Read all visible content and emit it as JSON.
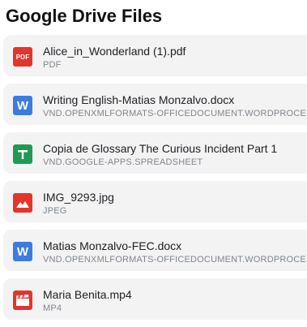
{
  "page": {
    "title": "Google Drive Files"
  },
  "files": [
    {
      "name": "Alice_in_Wonderland (1).pdf",
      "type": "PDF",
      "icon": "pdf-icon",
      "icon_text": "PDF",
      "icon_color": "#e2352c"
    },
    {
      "name": "Writing English-Matias Monzalvo.docx",
      "type": "VND.OPENXMLFORMATS-OFFICEDOCUMENT.WORDPROCESSINGML.DOCUMENT",
      "icon": "word-doc-icon",
      "icon_text": "W",
      "icon_color": "#3e7be0"
    },
    {
      "name": "Copia de Glossary The Curious Incident Part 1",
      "type": "VND.GOOGLE-APPS.SPREADSHEET",
      "icon": "spreadsheet-icon",
      "icon_color": "#1f9a55"
    },
    {
      "name": "IMG_9293.jpg",
      "type": "JPEG",
      "icon": "image-icon",
      "icon_color": "#e2352c"
    },
    {
      "name": "Matias Monzalvo-FEC.docx",
      "type": "VND.OPENXMLFORMATS-OFFICEDOCUMENT.WORDPROCESSINGML.DOCUMENT",
      "icon": "word-doc-icon",
      "icon_text": "W",
      "icon_color": "#3e7be0"
    },
    {
      "name": "Maria Benita.mp4",
      "type": "MP4",
      "icon": "video-icon",
      "icon_color": "#e2352c"
    }
  ]
}
